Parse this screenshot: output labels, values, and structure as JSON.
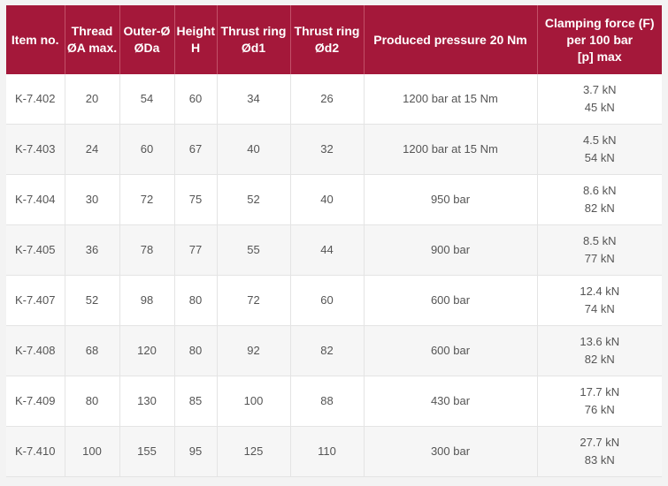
{
  "header": {
    "item_no": [
      "Item no."
    ],
    "thread": [
      "Thread",
      "ØA max."
    ],
    "outer": [
      "Outer-Ø",
      "ØDa"
    ],
    "height": [
      "Height",
      "H"
    ],
    "thrust1": [
      "Thrust ring",
      "Ød1"
    ],
    "thrust2": [
      "Thrust ring",
      "Ød2"
    ],
    "pressure": [
      "Produced pressure 20 Nm"
    ],
    "clamping": [
      "Clamping force (F)",
      "per 100 bar",
      "[p] max"
    ]
  },
  "rows": [
    {
      "item": "K-7.402",
      "thread": "20",
      "outer": "54",
      "height": "60",
      "d1": "34",
      "d2": "26",
      "pressure": "1200 bar at 15 Nm",
      "force": [
        "3.7 kN",
        "45 kN"
      ]
    },
    {
      "item": "K-7.403",
      "thread": "24",
      "outer": "60",
      "height": "67",
      "d1": "40",
      "d2": "32",
      "pressure": "1200 bar at 15 Nm",
      "force": [
        "4.5 kN",
        "54 kN"
      ]
    },
    {
      "item": "K-7.404",
      "thread": "30",
      "outer": "72",
      "height": "75",
      "d1": "52",
      "d2": "40",
      "pressure": "950 bar",
      "force": [
        "8.6 kN",
        "82 kN"
      ]
    },
    {
      "item": "K-7.405",
      "thread": "36",
      "outer": "78",
      "height": "77",
      "d1": "55",
      "d2": "44",
      "pressure": "900 bar",
      "force": [
        "8.5 kN",
        "77 kN"
      ]
    },
    {
      "item": "K-7.407",
      "thread": "52",
      "outer": "98",
      "height": "80",
      "d1": "72",
      "d2": "60",
      "pressure": "600 bar",
      "force": [
        "12.4 kN",
        "74 kN"
      ]
    },
    {
      "item": "K-7.408",
      "thread": "68",
      "outer": "120",
      "height": "80",
      "d1": "92",
      "d2": "82",
      "pressure": "600 bar",
      "force": [
        "13.6 kN",
        "82 kN"
      ]
    },
    {
      "item": "K-7.409",
      "thread": "80",
      "outer": "130",
      "height": "85",
      "d1": "100",
      "d2": "88",
      "pressure": "430 bar",
      "force": [
        "17.7 kN",
        "76 kN"
      ]
    },
    {
      "item": "K-7.410",
      "thread": "100",
      "outer": "155",
      "height": "95",
      "d1": "125",
      "d2": "110",
      "pressure": "300 bar",
      "force": [
        "27.7 kN",
        "83 kN"
      ]
    }
  ],
  "colors": {
    "header_bg": "#a4183a",
    "header_text": "#ffffff",
    "cell_text": "#555555",
    "row_alt_bg": "#f6f6f6"
  }
}
